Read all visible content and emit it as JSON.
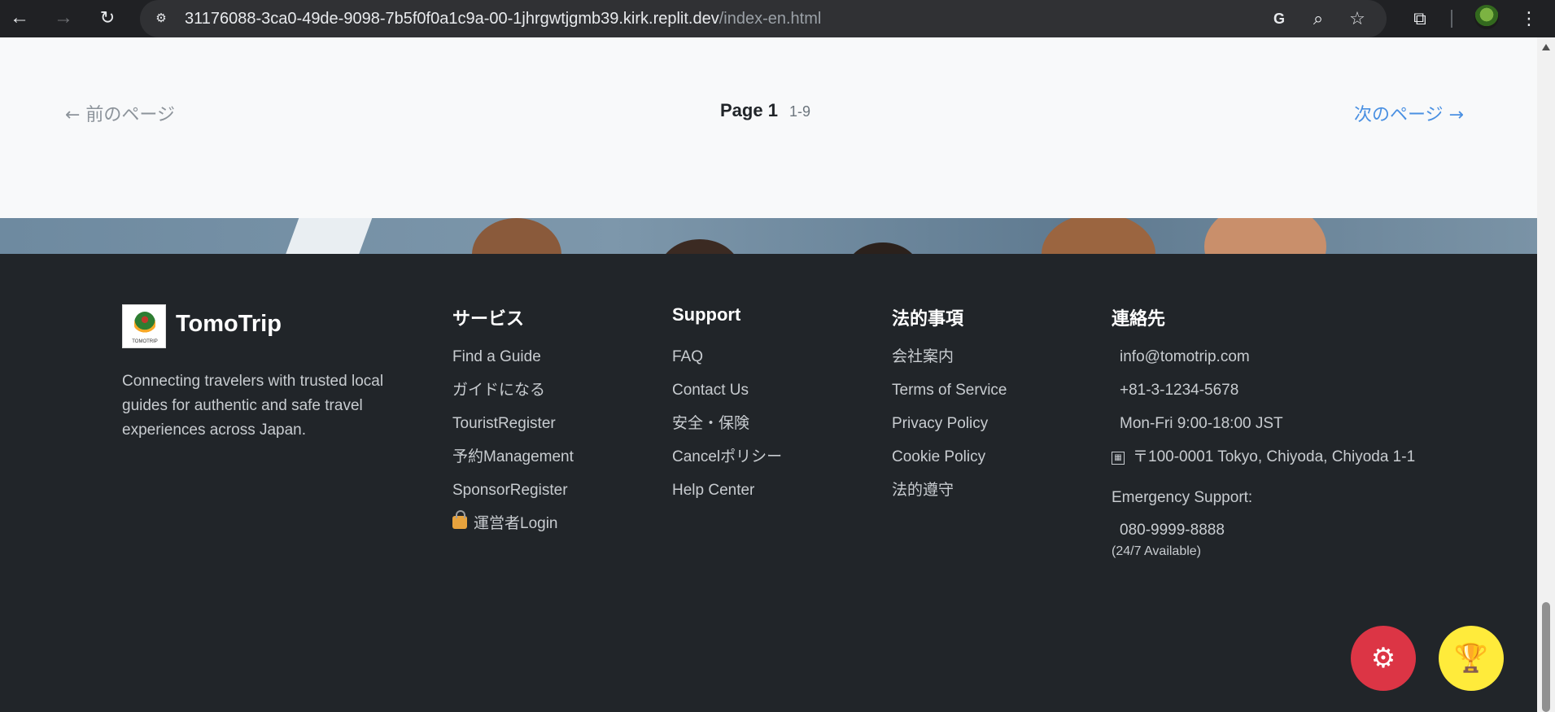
{
  "browser": {
    "url_host": "31176088-3ca0-49de-9098-7b5f0f0a1c9a-00-1jhrgwtjgmb39.kirk.replit.dev",
    "url_path": "/index-en.html",
    "icons": [
      "back-arrow-icon",
      "forward-arrow-icon",
      "reload-icon",
      "site-settings-icon",
      "translate-icon",
      "zoom-icon",
      "bookmark-star-icon",
      "extensions-icon",
      "profile-avatar",
      "menu-kebab-icon"
    ]
  },
  "pagination": {
    "prev": "← 前のページ",
    "page_label": "Page 1",
    "page_range": "1-9",
    "next": "次のページ →"
  },
  "footer": {
    "brand_name": "TomoTrip",
    "logo_text": "TOMOTRIP",
    "description": "Connecting travelers with trusted local guides for authentic and safe travel experiences across Japan.",
    "services": {
      "title": "サービス",
      "items": [
        "Find a Guide",
        "ガイドになる",
        "TouristRegister",
        "予約Management",
        "SponsorRegister",
        "運営者Login"
      ]
    },
    "support": {
      "title": "Support",
      "items": [
        "FAQ",
        "Contact Us",
        "安全・保険",
        "Cancelポリシー",
        "Help Center"
      ]
    },
    "legal": {
      "title": "法的事項",
      "items": [
        "会社案内",
        "Terms of Service",
        "Privacy Policy",
        "Cookie Policy",
        "法的遵守"
      ]
    },
    "contact": {
      "title": "連絡先",
      "email": "info@tomotrip.com",
      "phone": "+81-3-1234-5678",
      "hours": "Mon-Fri 9:00-18:00 JST",
      "address": "〒100-0001 Tokyo, Chiyoda, Chiyoda 1-1",
      "emergency_label": "Emergency Support:",
      "emergency_phone": "080-9999-8888",
      "emergency_note": "(24/7 Available)"
    }
  },
  "colors": {
    "footer_bg": "#212529",
    "pagination_bg": "#f8f9fa",
    "next_link": "#4a90e2",
    "fab_settings": "#dc3545",
    "fab_trophy": "#ffeb3b"
  }
}
